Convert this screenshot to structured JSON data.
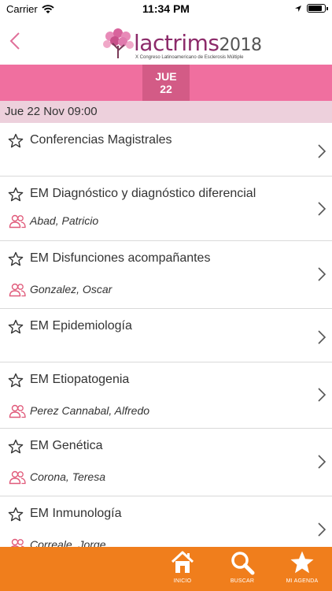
{
  "status_bar": {
    "carrier": "Carrier",
    "time": "11:34 PM",
    "battery_level": 0.9
  },
  "header": {
    "logo_name": "lactrims",
    "logo_year": "2018",
    "logo_subtitle": "X Congreso Latinoamericano de Esclerosis Múltiple"
  },
  "day_tab": {
    "day_name": "JUE",
    "day_number": "22"
  },
  "date_header": "Jue 22 Nov 09:00",
  "sessions": [
    {
      "title": "Conferencias Magistrales",
      "speaker": ""
    },
    {
      "title": "EM Diagnóstico y diagnóstico diferencial",
      "speaker": "Abad, Patricio"
    },
    {
      "title": "EM Disfunciones acompañantes",
      "speaker": "Gonzalez, Oscar"
    },
    {
      "title": "EM Epidemiología",
      "speaker": ""
    },
    {
      "title": "EM Etiopatogenia",
      "speaker": "Perez Cannabal, Alfredo"
    },
    {
      "title": "EM Genética",
      "speaker": "Corona, Teresa"
    },
    {
      "title": "EM Inmunología",
      "speaker": "Correale, Jorge"
    }
  ],
  "tabs": {
    "inicio": "INICIO",
    "buscar": "BUSCAR",
    "mi_agenda": "MI AGENDA"
  },
  "colors": {
    "primary_pink": "#f06f9f",
    "selected_day": "#d35b86",
    "date_header_bg": "#edd0dc",
    "tab_bar": "#f07e1c",
    "speaker_icon": "#e05a7a"
  }
}
